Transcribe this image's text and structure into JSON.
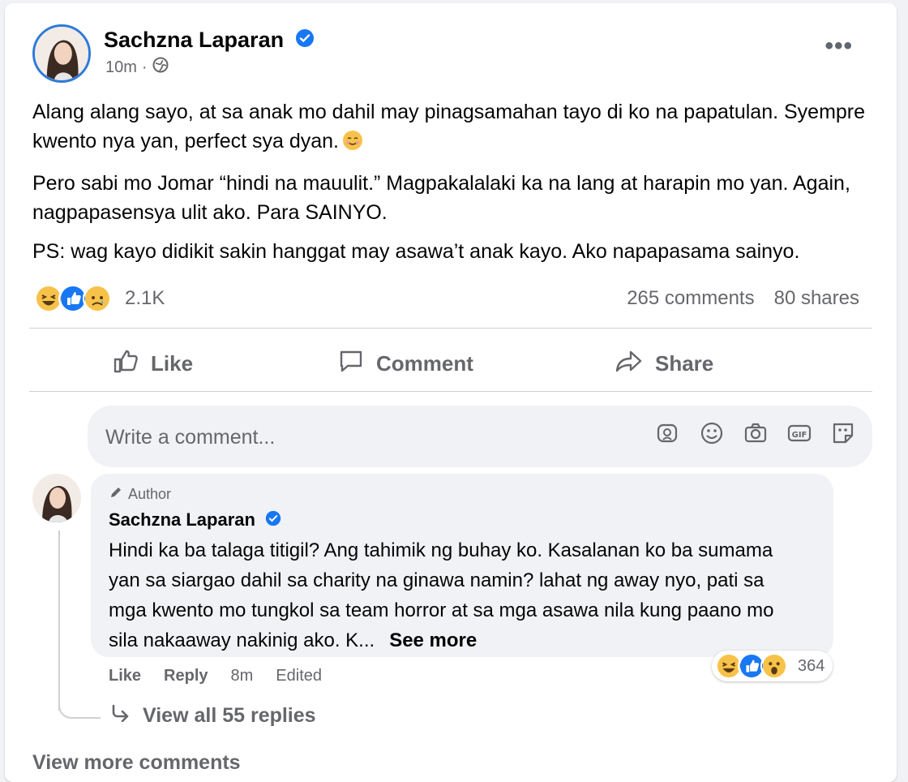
{
  "post": {
    "author": "Sachzna Laparan",
    "time": "10m",
    "dot": "·",
    "paragraphs": [
      "Alang alang sayo, at sa anak mo dahil may pinagsamahan tayo di ko na papatulan. Syempre kwento nya yan, perfect sya dyan.",
      "Pero sabi mo Jomar “hindi na mauulit.” Magpakalalaki ka na lang at harapin mo yan. Again, nagpapasensya ulit ako. Para SAINYO.",
      "PS: wag kayo didikit sakin hanggat may asawa’t anak kayo. Ako napapasama sainyo."
    ],
    "reaction_count": "2.1K",
    "comments_count": "265 comments",
    "shares_count": "80 shares",
    "actions": {
      "like": "Like",
      "comment": "Comment",
      "share": "Share"
    },
    "more": "•••"
  },
  "composer": {
    "placeholder": "Write a comment..."
  },
  "comment": {
    "badge": "Author",
    "author": "Sachzna Laparan",
    "text": "Hindi ka ba talaga titigil? Ang tahimik ng buhay ko. Kasalanan ko ba sumama yan sa siargao dahil sa charity na ginawa namin? lahat ng away nyo, pati sa mga kwento mo tungkol sa team horror at sa mga asawa nila kung paano mo sila nakaaway nakinig ako. K...",
    "see_more": "See more",
    "like": "Like",
    "reply": "Reply",
    "time": "8m",
    "edited": "Edited",
    "reaction_count": "364",
    "view_replies": "View all 55 replies"
  },
  "view_more": "View more comments",
  "colors": {
    "accent": "#1877f2",
    "muted": "#65676b",
    "bubble": "#f0f2f5"
  }
}
